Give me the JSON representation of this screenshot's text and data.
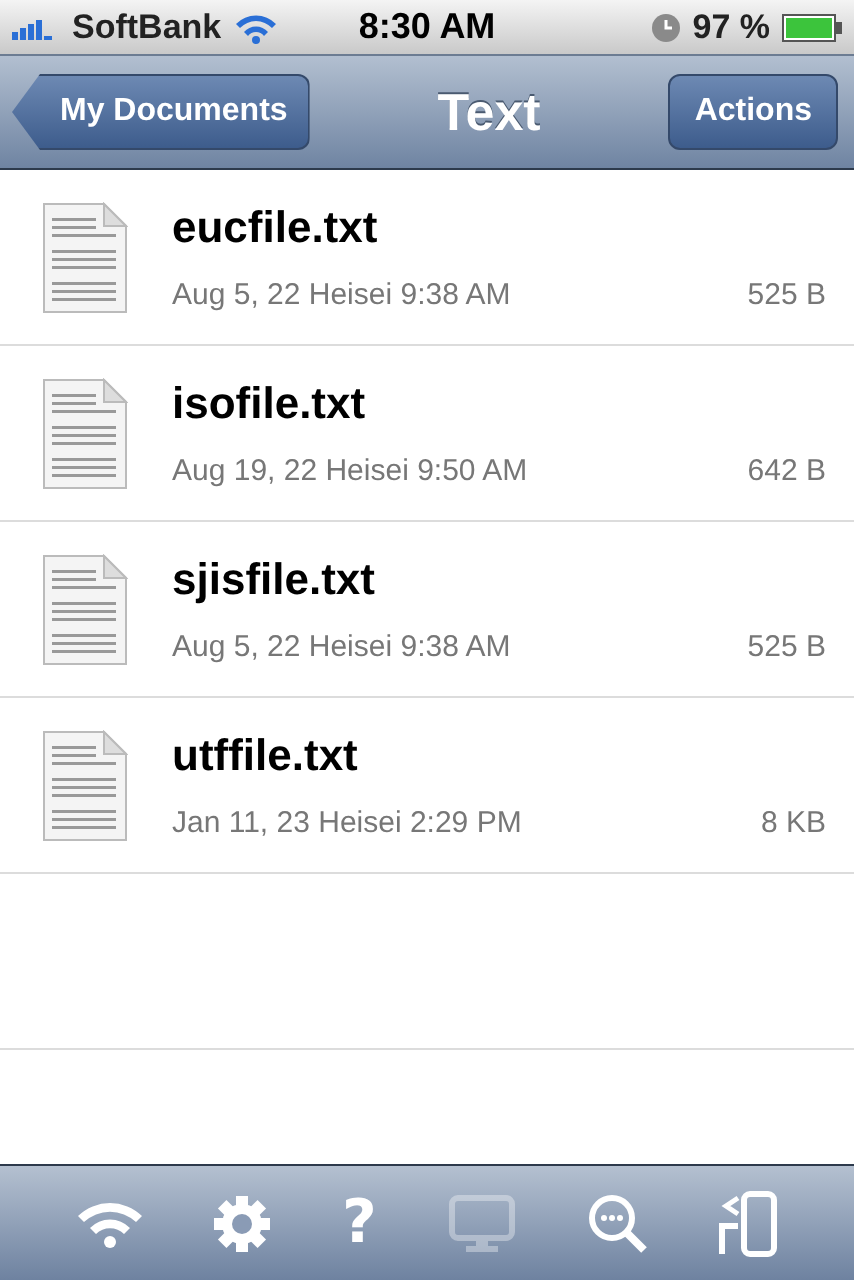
{
  "status_bar": {
    "carrier": "SoftBank",
    "time": "8:30 AM",
    "battery": "97 %"
  },
  "nav_bar": {
    "back": "My Documents",
    "title": "Text",
    "action": "Actions"
  },
  "files": [
    {
      "name": "eucfile.txt",
      "date": "Aug 5, 22 Heisei 9:38 AM",
      "size": "525 B"
    },
    {
      "name": "isofile.txt",
      "date": "Aug 19, 22 Heisei 9:50 AM",
      "size": "642 B"
    },
    {
      "name": "sjisfile.txt",
      "date": "Aug 5, 22 Heisei 9:38 AM",
      "size": "525 B"
    },
    {
      "name": "utffile.txt",
      "date": "Jan 11, 23 Heisei 2:29 PM",
      "size": "8 KB"
    }
  ],
  "toolbar": [
    {
      "kind": "wifi",
      "disabled": false
    },
    {
      "kind": "gear",
      "disabled": false
    },
    {
      "kind": "help",
      "label": "?",
      "disabled": false
    },
    {
      "kind": "monitor",
      "disabled": true
    },
    {
      "kind": "search",
      "disabled": false
    },
    {
      "kind": "swap",
      "disabled": false
    }
  ]
}
